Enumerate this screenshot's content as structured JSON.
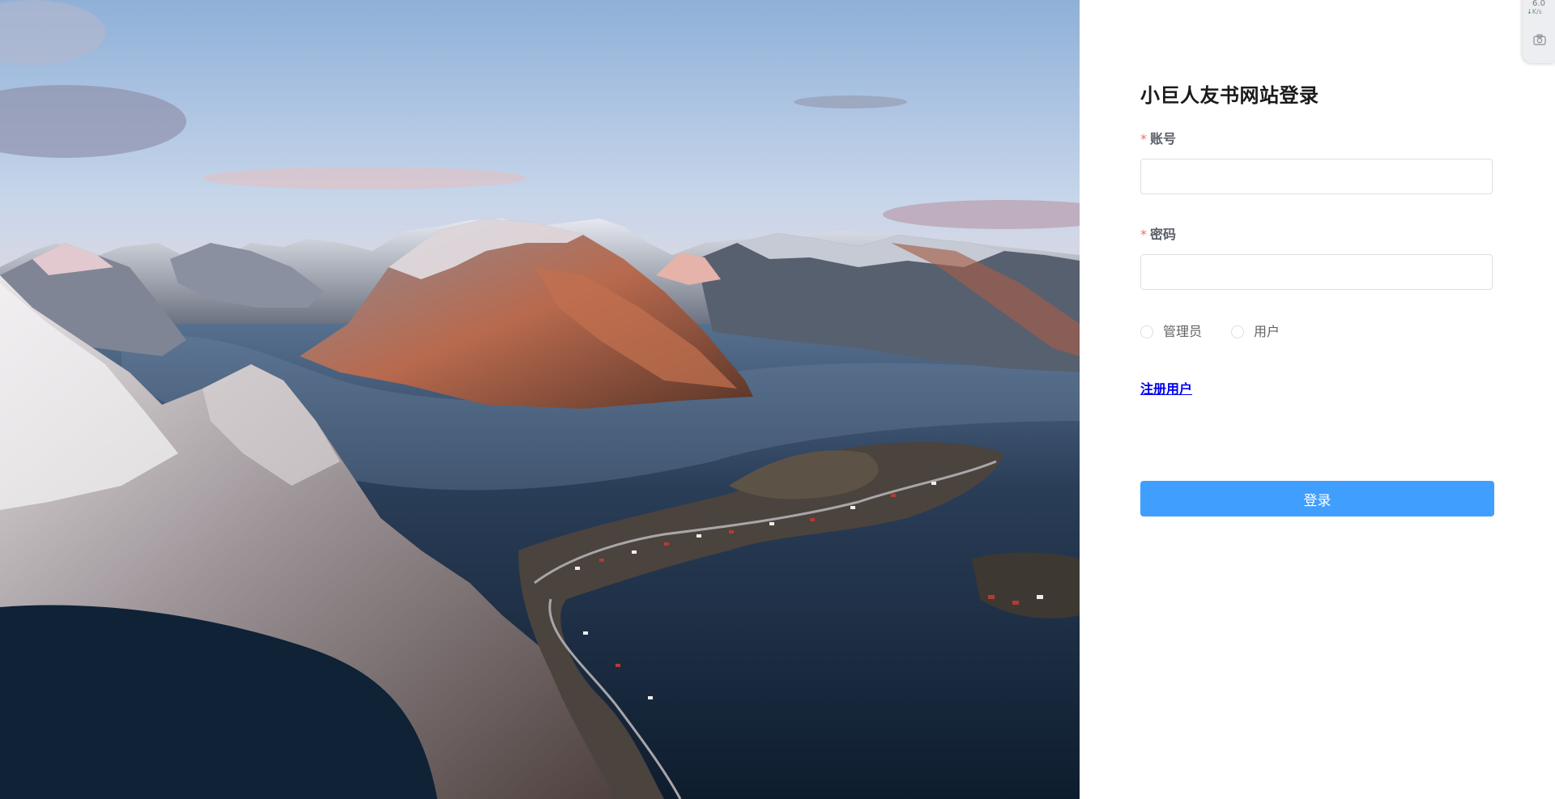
{
  "login": {
    "title": "小巨人友书网站登录",
    "required_mark": "*",
    "account_label": "账号",
    "account_value": "",
    "password_label": "密码",
    "password_value": "",
    "roles": [
      {
        "label": "管理员",
        "selected": false
      },
      {
        "label": "用户",
        "selected": false
      }
    ],
    "register_link": "注册用户",
    "submit_label": "登录"
  },
  "widget": {
    "speed_value": "6.0",
    "speed_unit": "K/s",
    "speed_icon": "download-arrow-icon",
    "action_icon": "camera-icon"
  },
  "colors": {
    "primary": "#409eff",
    "required": "#f56c6c",
    "link": "#0000ee",
    "input_border": "#dcdfe6"
  },
  "hero": {
    "image_icon": "mountain-fjord-landscape"
  }
}
